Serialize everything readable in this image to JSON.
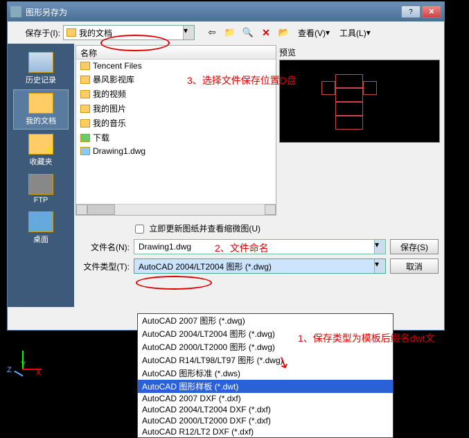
{
  "titlebar": {
    "title": "图形另存为"
  },
  "toprow": {
    "save_in_label": "保存于(I):",
    "combo_value": "我的文档",
    "view_label": "查看(V)",
    "tools_label": "工具(L)"
  },
  "sidebar": {
    "items": [
      {
        "label": "历史记录"
      },
      {
        "label": "我的文档"
      },
      {
        "label": "收藏夹"
      },
      {
        "label": "FTP"
      },
      {
        "label": "桌面"
      }
    ]
  },
  "filelist": {
    "header": "名称",
    "items": [
      {
        "name": "Tencent Files",
        "kind": "folder"
      },
      {
        "name": "暴风影视库",
        "kind": "folder"
      },
      {
        "name": "我的视频",
        "kind": "folder"
      },
      {
        "name": "我的图片",
        "kind": "folder"
      },
      {
        "name": "我的音乐",
        "kind": "folder"
      },
      {
        "name": "下载",
        "kind": "dl"
      },
      {
        "name": "Drawing1.dwg",
        "kind": "dwg"
      }
    ]
  },
  "preview": {
    "label": "预览"
  },
  "checkbox": {
    "label": "立即更新图纸并查看缩微图(U)"
  },
  "filename": {
    "label": "文件名(N):",
    "value": "Drawing1.dwg"
  },
  "filetype": {
    "label": "文件类型(T):",
    "value": "AutoCAD 2004/LT2004 图形 (*.dwg)",
    "options": [
      "AutoCAD 2007 图形 (*.dwg)",
      "AutoCAD 2004/LT2004 图形 (*.dwg)",
      "AutoCAD 2000/LT2000 图形 (*.dwg)",
      "AutoCAD R14/LT98/LT97 图形 (*.dwg)",
      "AutoCAD 图形标准 (*.dws)",
      "AutoCAD 图形样板 (*.dwt)",
      "AutoCAD 2007 DXF (*.dxf)",
      "AutoCAD 2004/LT2004 DXF (*.dxf)",
      "AutoCAD 2000/LT2000 DXF (*.dxf)",
      "AutoCAD R12/LT2 DXF (*.dxf)"
    ]
  },
  "buttons": {
    "save": "保存(S)",
    "cancel": "取消"
  },
  "annotations": {
    "a3": "3、选择文件保存位置D盘",
    "a2": "2、文件命名",
    "a1": "1、保存类型为模板后缀名dwt文"
  },
  "axis": {
    "x": "X",
    "y": "Y",
    "z": "Z"
  }
}
